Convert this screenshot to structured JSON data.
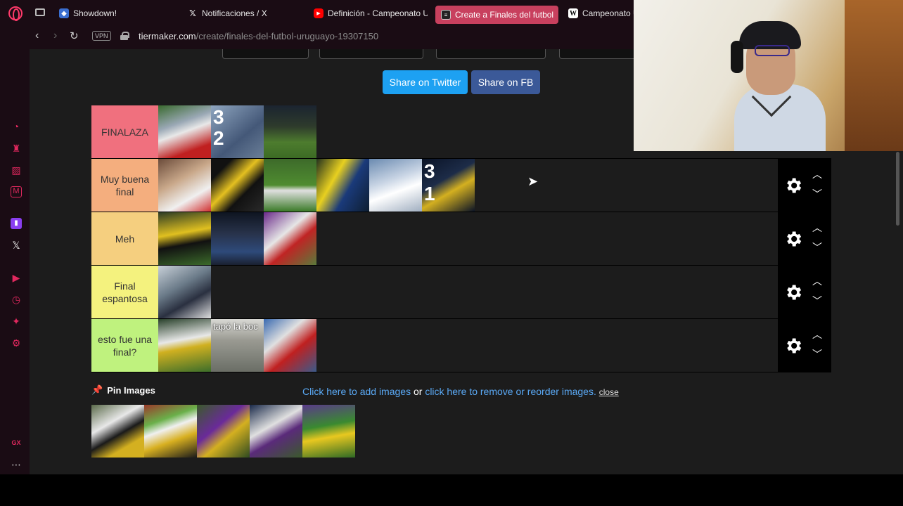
{
  "browser": {
    "tabs": [
      {
        "label": "Showdown!",
        "icon": "showdown-icon",
        "active": false
      },
      {
        "label": "Notificaciones / X",
        "icon": "x-icon",
        "active": false
      },
      {
        "label": "Definición - Campeonato U",
        "icon": "youtube-icon",
        "active": false
      },
      {
        "label": "Create a Finales del futbol",
        "icon": "tiermaker-icon",
        "active": true
      },
      {
        "label": "Campeonato U",
        "icon": "wikipedia-icon",
        "active": false
      }
    ],
    "vpn_label": "VPN",
    "url_host": "tiermaker.com",
    "url_path": "/create/finales-del-futbol-uruguayo-19307150"
  },
  "share": {
    "twitter_label": "Share on Twitter",
    "fb_label": "Share on FB"
  },
  "tiers": [
    {
      "label": "FINALAZA",
      "color": "#f0707e",
      "image_count": 3,
      "number_badge": "3 2"
    },
    {
      "label": "Muy buena final",
      "color": "#f4ae7e",
      "image_count": 6,
      "number_badge": "3 1"
    },
    {
      "label": "Meh",
      "color": "#f5cf7f",
      "image_count": 3
    },
    {
      "label": "Final espantosa",
      "color": "#f4f27e",
      "image_count": 1
    },
    {
      "label": "esto fue una final?",
      "color": "#bff27e",
      "image_count": 3,
      "overlay_text": "tapó la boc"
    }
  ],
  "pin": {
    "label": "Pin Images",
    "add_link": "Click here to add images",
    "or_text": "or",
    "remove_link": "click here to remove or reorder images.",
    "close_label": "close"
  },
  "pool": {
    "image_count": 5
  },
  "colors": {
    "browser_bg": "#1a0c14",
    "accent": "#e0285e",
    "page_bg": "#1c1c1c",
    "twitter": "#1da1f2",
    "facebook": "#3b5998"
  }
}
